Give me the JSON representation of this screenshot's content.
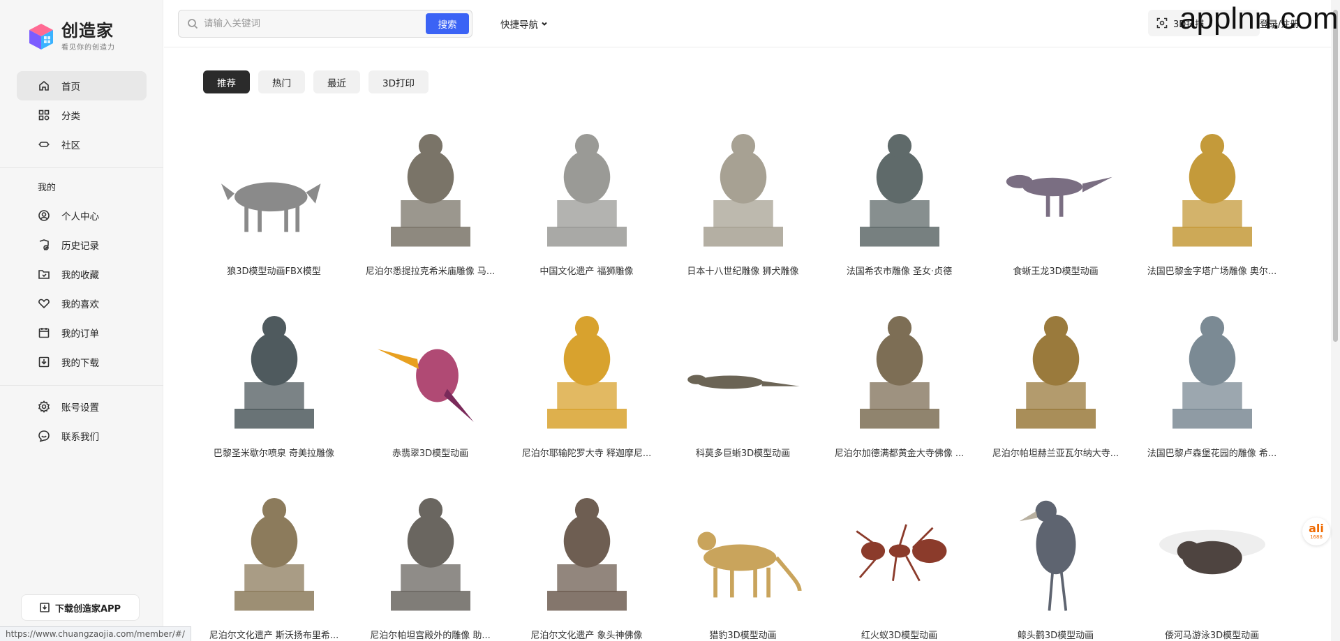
{
  "logo": {
    "title": "创造家",
    "subtitle": "看见你的创造力",
    "colors": [
      "#ff5c8a",
      "#7b5cff",
      "#3fb8ff"
    ]
  },
  "sidebar": {
    "main_items": [
      {
        "label": "首页",
        "icon": "home-icon",
        "active": true
      },
      {
        "label": "分类",
        "icon": "grid-icon",
        "active": false
      },
      {
        "label": "社区",
        "icon": "community-icon",
        "active": false
      }
    ],
    "mine_label": "我的",
    "mine_items": [
      {
        "label": "个人中心",
        "icon": "user-icon"
      },
      {
        "label": "历史记录",
        "icon": "history-icon"
      },
      {
        "label": "我的收藏",
        "icon": "folder-icon"
      },
      {
        "label": "我的喜欢",
        "icon": "heart-icon"
      },
      {
        "label": "我的订单",
        "icon": "calendar-icon"
      },
      {
        "label": "我的下载",
        "icon": "download-icon"
      }
    ],
    "bottom_items": [
      {
        "label": "账号设置",
        "icon": "gear-icon"
      },
      {
        "label": "联系我们",
        "icon": "chat-icon"
      }
    ],
    "download_app": "下载创造家APP"
  },
  "header": {
    "search_placeholder": "请输入关键词",
    "search_button": "搜索",
    "quick_nav": "快捷导航",
    "btn_right_1": "3D扫描",
    "btn_right_2": "登录/注册",
    "watermark": "applnn.com",
    "accent": "#3b63f5"
  },
  "tabs": [
    {
      "label": "推荐",
      "active": true
    },
    {
      "label": "热门",
      "active": false
    },
    {
      "label": "最近",
      "active": false
    },
    {
      "label": "3D打印",
      "active": false
    }
  ],
  "models": [
    {
      "title": "狼3D模型动画FBX模型",
      "icon": "wolf-icon",
      "color": "#8a8a8a"
    },
    {
      "title": "尼泊尔悉提拉克希米庙雕像 马...",
      "icon": "horse-statue-icon",
      "color": "#7a7468"
    },
    {
      "title": "中国文化遗产 福狮雕像",
      "icon": "lion-pedestal-icon",
      "color": "#9a9a96"
    },
    {
      "title": "日本十八世纪雕像 狮犬雕像",
      "icon": "lion-dog-statue-icon",
      "color": "#a7a193"
    },
    {
      "title": "法国希农市雕像 圣女·贞德",
      "icon": "equestrian-bronze-icon",
      "color": "#5f6a6a"
    },
    {
      "title": "食蜥王龙3D模型动画",
      "icon": "dinosaur-icon",
      "color": "#7a6e82"
    },
    {
      "title": "法国巴黎金字塔广场雕像 奥尔...",
      "icon": "gold-equestrian-icon",
      "color": "#c49a3a"
    },
    {
      "title": "巴黎圣米歇尔喷泉 奇美拉雕像",
      "icon": "chimera-icon",
      "color": "#4f5a5e"
    },
    {
      "title": "赤翡翠3D模型动画",
      "icon": "kingfisher-icon",
      "color": "#b04a74"
    },
    {
      "title": "尼泊尔耶输陀罗大寺 释迦摩尼...",
      "icon": "buddha-icon",
      "color": "#d8a22e"
    },
    {
      "title": "科莫多巨蜥3D模型动画",
      "icon": "komodo-icon",
      "color": "#6b6455"
    },
    {
      "title": "尼泊尔加德满都黄金大寺佛像 ...",
      "icon": "temple-statue-icon",
      "color": "#7d6e55"
    },
    {
      "title": "尼泊尔帕坦赫兰亚瓦尔纳大寺...",
      "icon": "monkey-statue-icon",
      "color": "#9a7a3c"
    },
    {
      "title": "法国巴黎卢森堡花园的雕像 希...",
      "icon": "dancer-statue-icon",
      "color": "#7b8a94"
    },
    {
      "title": "尼泊尔文化遗产 斯沃扬布里希...",
      "icon": "stone-lion-icon",
      "color": "#8c7b5c"
    },
    {
      "title": "尼泊尔帕坦宫殿外的雕像 助...",
      "icon": "deity-relief-icon",
      "color": "#6a6660"
    },
    {
      "title": "尼泊尔文化遗产 象头神佛像",
      "icon": "ganesha-icon",
      "color": "#6e5e52"
    },
    {
      "title": "猎豹3D模型动画",
      "icon": "cheetah-icon",
      "color": "#c9a45c"
    },
    {
      "title": "红火蚁3D模型动画",
      "icon": "ant-icon",
      "color": "#8b3b2b"
    },
    {
      "title": "鲸头鹳3D模型动画",
      "icon": "shoebill-icon",
      "color": "#5e6470"
    },
    {
      "title": "倭河马游泳3D模型动画",
      "icon": "hippo-icon",
      "color": "#4e4440"
    }
  ],
  "status_bar_url": "https://www.chuangzaojia.com/member/#/",
  "badge_1688": {
    "top": "ali",
    "bottom": "1688"
  }
}
